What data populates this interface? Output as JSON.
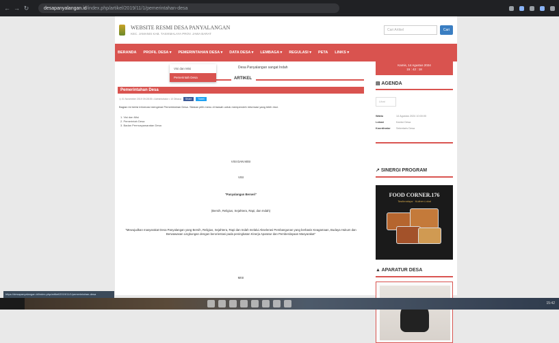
{
  "browser": {
    "url_host": "desapanyalangan.id",
    "url_path": "/index.php/artikel/2019/11/1/pemerintahan-desa",
    "nav": [
      "←",
      "→",
      "↻"
    ]
  },
  "header": {
    "title": "WEBSITE RESMI DESA PANYALANGAN",
    "subtitle": "KEC. JAMANIS KAB. TASIKMALAYA PROV. JAWA BARAT"
  },
  "search": {
    "placeholder": "Cari Artikel",
    "button": "Cari"
  },
  "menu": [
    "BERANDA",
    "PROFIL DESA ▾",
    "PEMERINTAHAN DESA ▾",
    "DATA DESA ▾",
    "LEMBAGA ▾",
    "REGULASI ▾",
    "PETA",
    "LINKS ▾"
  ],
  "dropdown": {
    "items": [
      "Visi dan Misi",
      "Pemerintah Desa"
    ],
    "active_index": 1
  },
  "marquee": "Desa Panyalangan sangat Indah",
  "section_label": "ARTIKEL",
  "post": {
    "title": "Pemerintahan Desa",
    "meta": "◷ 01 November 2019 09:28:35  • Administrator  • 10 Dibaca",
    "share_fb": "Share",
    "share_tw": "Tweet",
    "intro": "Bagian ini berisi informasi mengenai Pemerintahan Desa. Silakan pilih menu di bawah untuk memperoleh informasi yang lebih rinci.",
    "list": [
      "1. Visi dan Misi",
      "2. Pemerintah Desa",
      "3. Badan Permusyawaratan Desa"
    ],
    "vm_heading": "VISI DAN MISI",
    "visi": "VISI",
    "motto": "\"Panyalangan Berseri\"",
    "motto_desc": "(Bersih, Religius, Sejahtera, Rapi, dan Indah)",
    "visi_text": "\"Mewujudkan masyarakat Desa Panyalangan yang Bersih, Religius, Sejahtera, Rapi dan Indah melalui Akselerasi Pembangunan yang berbasis Keagamaan, Budaya Hukum dan Berwawasan Lingkungan dengan berorientasi pada peningkatan Kinerja Aparatur dan Pemberdayaan Masyarakat\"",
    "misi": "MISI"
  },
  "sidebar": {
    "date_line1": "Kamis, 14 Agustus 2024",
    "date_line2": "15 : 42 : 18",
    "agenda_title": "AGENDA",
    "agenda_tab": "Lihat",
    "agenda_rows": [
      {
        "k": "Waktu",
        "v": "14 Agustus 2024 10:00:00"
      },
      {
        "k": "Lokasi",
        "v": "Kantor Desa"
      },
      {
        "k": "Koordinator",
        "v": "Sekretaris Desa"
      }
    ],
    "program_title": "SINERGI PROGRAM",
    "food_title": "FOOD CORNER.176",
    "food_subtitle": "Tasikmalaya · Kuliner Lokal",
    "aparatur_title": "APARATUR DESA"
  },
  "statusbar": "https://desapanyalangan.id/index.php/artikel/2019/11/1/pemerintahan-desa",
  "taskbar": {
    "clock": "15:42"
  },
  "colors": {
    "accent": "#d9534f",
    "primary": "#3a7ec2",
    "chrome": "#202124"
  }
}
